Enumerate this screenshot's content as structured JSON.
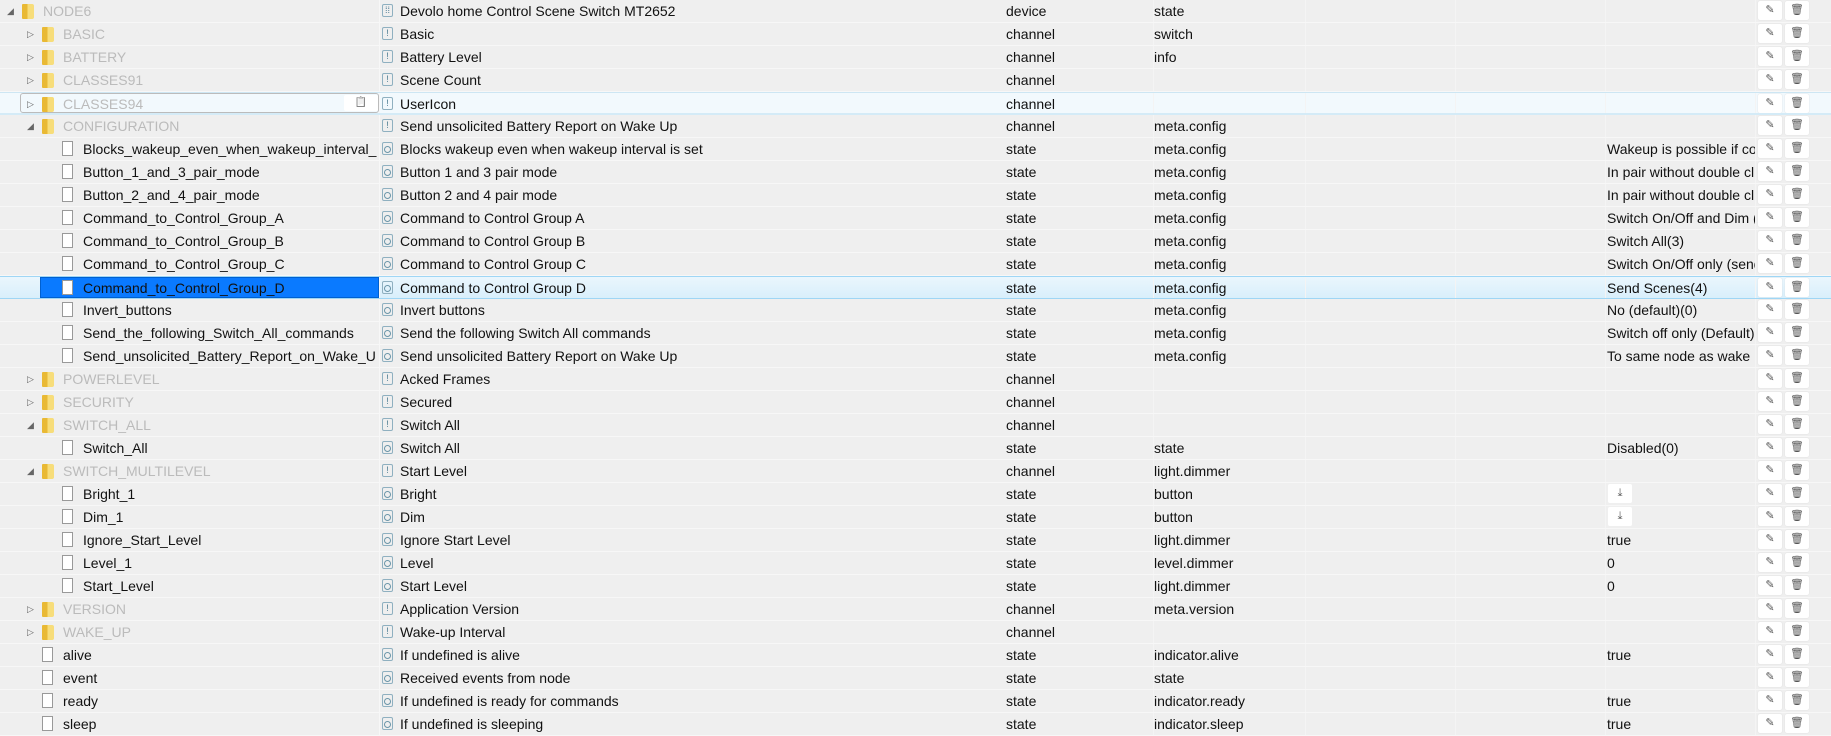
{
  "colors": {
    "selection": "#0a7aff",
    "channel_text": "#bbbbbb",
    "folder": "#e9b934"
  },
  "icons": {
    "edit": "pencil-icon",
    "delete": "trash-icon",
    "download": "download-icon",
    "clipboard": "clipboard-icon"
  },
  "rows": [
    {
      "level": 0,
      "kind": "folder",
      "expanded": true,
      "name": "NODE6",
      "common_name": "Devolo home Control Scene Switch MT2652",
      "icon": "device",
      "type": "device",
      "role": "state",
      "value": ""
    },
    {
      "level": 1,
      "kind": "folder",
      "expanded": false,
      "name": "BASIC",
      "common_name": "Basic",
      "icon": "channel",
      "type": "channel",
      "role": "switch",
      "value": ""
    },
    {
      "level": 1,
      "kind": "folder",
      "expanded": false,
      "name": "BATTERY",
      "common_name": "Battery Level",
      "icon": "channel",
      "type": "channel",
      "role": "info",
      "value": ""
    },
    {
      "level": 1,
      "kind": "folder",
      "expanded": false,
      "name": "CLASSES91",
      "common_name": "Scene Count",
      "icon": "channel",
      "type": "channel",
      "role": "",
      "value": ""
    },
    {
      "level": 1,
      "kind": "folder",
      "expanded": false,
      "name": "CLASSES94",
      "common_name": "UserIcon",
      "icon": "channel",
      "type": "channel",
      "role": "",
      "value": "",
      "state": "hover"
    },
    {
      "level": 1,
      "kind": "folder",
      "expanded": true,
      "name": "CONFIGURATION",
      "common_name": "Send unsolicited Battery Report on Wake Up",
      "icon": "channel",
      "type": "channel",
      "role": "meta.config",
      "value": ""
    },
    {
      "level": 2,
      "kind": "file",
      "name": "Blocks_wakeup_even_when_wakeup_interval_",
      "common_name": "Blocks wakeup even when wakeup interval is set",
      "icon": "state",
      "type": "state",
      "role": "meta.config",
      "value": "Wakeup is possible if co"
    },
    {
      "level": 2,
      "kind": "file",
      "name": "Button_1_and_3_pair_mode",
      "common_name": "Button 1 and 3 pair mode",
      "icon": "state",
      "type": "state",
      "role": "meta.config",
      "value": "In pair without double cl"
    },
    {
      "level": 2,
      "kind": "file",
      "name": "Button_2_and_4_pair_mode",
      "common_name": "Button 2 and 4 pair mode",
      "icon": "state",
      "type": "state",
      "role": "meta.config",
      "value": "In pair without double cl"
    },
    {
      "level": 2,
      "kind": "file",
      "name": "Command_to_Control_Group_A",
      "common_name": "Command to Control Group A",
      "icon": "state",
      "type": "state",
      "role": "meta.config",
      "value": "Switch On/Off and Dim ("
    },
    {
      "level": 2,
      "kind": "file",
      "name": "Command_to_Control_Group_B",
      "common_name": "Command to Control Group B",
      "icon": "state",
      "type": "state",
      "role": "meta.config",
      "value": "Switch All(3)"
    },
    {
      "level": 2,
      "kind": "file",
      "name": "Command_to_Control_Group_C",
      "common_name": "Command to Control Group C",
      "icon": "state",
      "type": "state",
      "role": "meta.config",
      "value": "Switch On/Off only (send"
    },
    {
      "level": 2,
      "kind": "file",
      "name": "Command_to_Control_Group_D",
      "common_name": "Command to Control Group D",
      "icon": "state",
      "type": "state",
      "role": "meta.config",
      "value": "Send Scenes(4)",
      "state": "selected"
    },
    {
      "level": 2,
      "kind": "file",
      "name": "Invert_buttons",
      "common_name": "Invert buttons",
      "icon": "state",
      "type": "state",
      "role": "meta.config",
      "value": "No (default)(0)"
    },
    {
      "level": 2,
      "kind": "file",
      "name": "Send_the_following_Switch_All_commands",
      "common_name": "Send the following Switch All commands",
      "icon": "state",
      "type": "state",
      "role": "meta.config",
      "value": "Switch off only (Default)"
    },
    {
      "level": 2,
      "kind": "file",
      "name": "Send_unsolicited_Battery_Report_on_Wake_U",
      "common_name": "Send unsolicited Battery Report on Wake Up",
      "icon": "state",
      "type": "state",
      "role": "meta.config",
      "value": "To same node as wake"
    },
    {
      "level": 1,
      "kind": "folder",
      "expanded": false,
      "name": "POWERLEVEL",
      "common_name": "Acked Frames",
      "icon": "channel",
      "type": "channel",
      "role": "",
      "value": ""
    },
    {
      "level": 1,
      "kind": "folder",
      "expanded": false,
      "name": "SECURITY",
      "common_name": "Secured",
      "icon": "channel",
      "type": "channel",
      "role": "",
      "value": ""
    },
    {
      "level": 1,
      "kind": "folder",
      "expanded": true,
      "name": "SWITCH_ALL",
      "common_name": "Switch All",
      "icon": "channel",
      "type": "channel",
      "role": "",
      "value": ""
    },
    {
      "level": 2,
      "kind": "file",
      "name": "Switch_All",
      "common_name": "Switch All",
      "icon": "state",
      "type": "state",
      "role": "state",
      "value": "Disabled(0)"
    },
    {
      "level": 1,
      "kind": "folder",
      "expanded": true,
      "name": "SWITCH_MULTILEVEL",
      "common_name": "Start Level",
      "icon": "channel",
      "type": "channel",
      "role": "light.dimmer",
      "value": ""
    },
    {
      "level": 2,
      "kind": "file",
      "name": "Bright_1",
      "common_name": "Bright",
      "icon": "state",
      "type": "state",
      "role": "button",
      "value": "",
      "download": true
    },
    {
      "level": 2,
      "kind": "file",
      "name": "Dim_1",
      "common_name": "Dim",
      "icon": "state",
      "type": "state",
      "role": "button",
      "value": "",
      "download": true
    },
    {
      "level": 2,
      "kind": "file",
      "name": "Ignore_Start_Level",
      "common_name": "Ignore Start Level",
      "icon": "state",
      "type": "state",
      "role": "light.dimmer",
      "value": "true"
    },
    {
      "level": 2,
      "kind": "file",
      "name": "Level_1",
      "common_name": "Level",
      "icon": "state",
      "type": "state",
      "role": "level.dimmer",
      "value": "0"
    },
    {
      "level": 2,
      "kind": "file",
      "name": "Start_Level",
      "common_name": "Start Level",
      "icon": "state",
      "type": "state",
      "role": "light.dimmer",
      "value": "0"
    },
    {
      "level": 1,
      "kind": "folder",
      "expanded": false,
      "name": "VERSION",
      "common_name": "Application Version",
      "icon": "channel",
      "type": "channel",
      "role": "meta.version",
      "value": ""
    },
    {
      "level": 1,
      "kind": "folder",
      "expanded": false,
      "name": "WAKE_UP",
      "common_name": "Wake-up Interval",
      "icon": "channel",
      "type": "channel",
      "role": "",
      "value": ""
    },
    {
      "level": 1,
      "kind": "file",
      "name": "alive",
      "common_name": "If undefined is alive",
      "icon": "state",
      "type": "state",
      "role": "indicator.alive",
      "value": "true"
    },
    {
      "level": 1,
      "kind": "file",
      "name": "event",
      "common_name": "Received events from node",
      "icon": "state",
      "type": "state",
      "role": "state",
      "value": ""
    },
    {
      "level": 1,
      "kind": "file",
      "name": "ready",
      "common_name": "If undefined is ready for commands",
      "icon": "state",
      "type": "state",
      "role": "indicator.ready",
      "value": "true"
    },
    {
      "level": 1,
      "kind": "file",
      "name": "sleep",
      "common_name": "If undefined is sleeping",
      "icon": "state",
      "type": "state",
      "role": "indicator.sleep",
      "value": "true"
    }
  ]
}
